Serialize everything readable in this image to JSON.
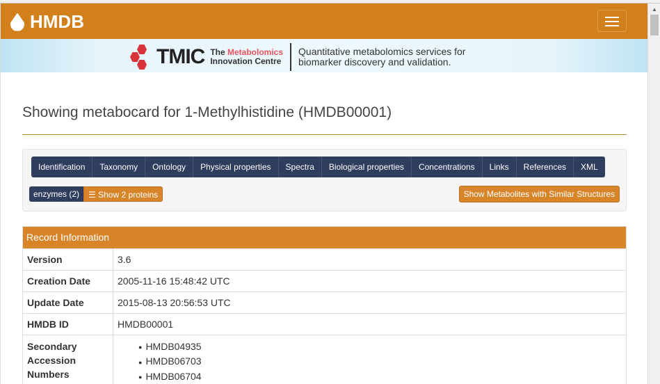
{
  "header": {
    "brand": "HMDB"
  },
  "banner": {
    "logo_word": "TMIC",
    "sub_the": "The",
    "sub_metab": "Metabolomics",
    "sub_line2": "Innovation Centre",
    "tagline1": "Quantitative metabolomics services for",
    "tagline2": "biomarker discovery and validation."
  },
  "page_title": "Showing metabocard for 1-Methylhistidine (HMDB00001)",
  "nav": [
    "Identification",
    "Taxonomy",
    "Ontology",
    "Physical properties",
    "Spectra",
    "Biological properties",
    "Concentrations",
    "Links",
    "References",
    "XML"
  ],
  "enzymes_label": "enzymes (2)",
  "show_proteins": "Show 2 proteins",
  "similar_button": "Show Metabolites with Similar Structures",
  "record": {
    "heading": "Record Information",
    "rows": [
      {
        "k": "Version",
        "v": "3.6"
      },
      {
        "k": "Creation Date",
        "v": "2005-11-16 15:48:42 UTC"
      },
      {
        "k": "Update Date",
        "v": "2015-08-13 20:56:53 UTC"
      },
      {
        "k": "HMDB ID",
        "v": "HMDB00001"
      }
    ],
    "secondary_label": "Secondary Accession Numbers",
    "secondary": [
      "HMDB04935",
      "HMDB06703",
      "HMDB06704"
    ]
  }
}
